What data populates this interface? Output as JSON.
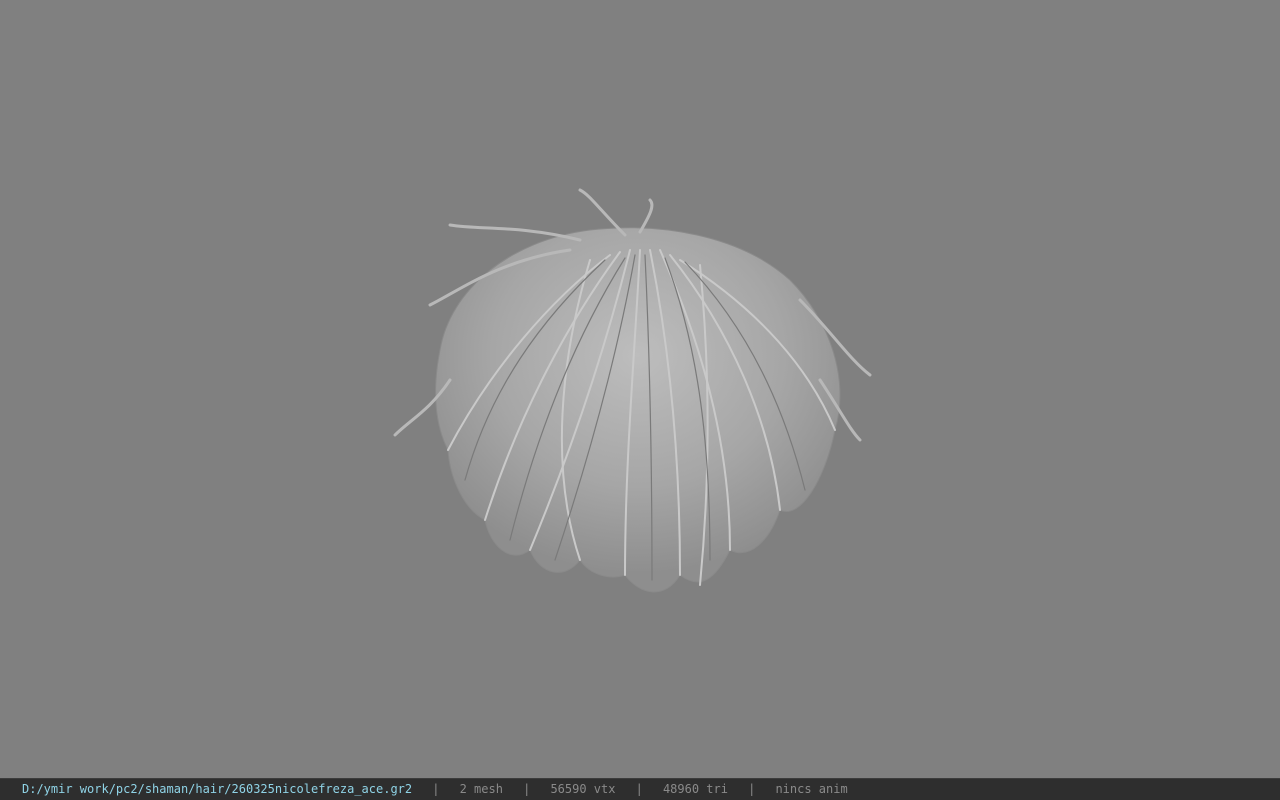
{
  "statusbar": {
    "file_path": "D:/ymir work/pc2/shaman/hair/260325nicolefreza_ace.gr2",
    "separator": "|",
    "mesh_count": "2 mesh",
    "vertex_count": "56590 vtx",
    "triangle_count": "48960 tri",
    "animation": "nincs anim"
  },
  "viewport": {
    "background_color": "#808080",
    "model": "hair-mesh"
  }
}
